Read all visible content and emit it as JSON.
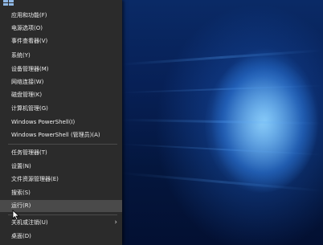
{
  "menu": {
    "items": [
      {
        "label": "应用和功能(F)"
      },
      {
        "label": "电源选项(O)"
      },
      {
        "label": "事件查看器(V)"
      },
      {
        "label": "系统(Y)"
      },
      {
        "label": "设备管理器(M)"
      },
      {
        "label": "网络连接(W)"
      },
      {
        "label": "磁盘管理(K)"
      },
      {
        "label": "计算机管理(G)"
      },
      {
        "label": "Windows PowerShell(I)"
      },
      {
        "label": "Windows PowerShell (管理员)(A)"
      },
      {
        "label": "任务管理器(T)"
      },
      {
        "label": "设置(N)"
      },
      {
        "label": "文件资源管理器(E)"
      },
      {
        "label": "搜索(S)"
      },
      {
        "label": "运行(R)"
      },
      {
        "label": "关机或注销(U)"
      },
      {
        "label": "桌面(D)"
      }
    ],
    "submenu_arrow": "›",
    "hovered_item": "运行(R)"
  },
  "icons": {
    "top_icon": "windows-icon",
    "cursor": "mouse-pointer-icon"
  }
}
